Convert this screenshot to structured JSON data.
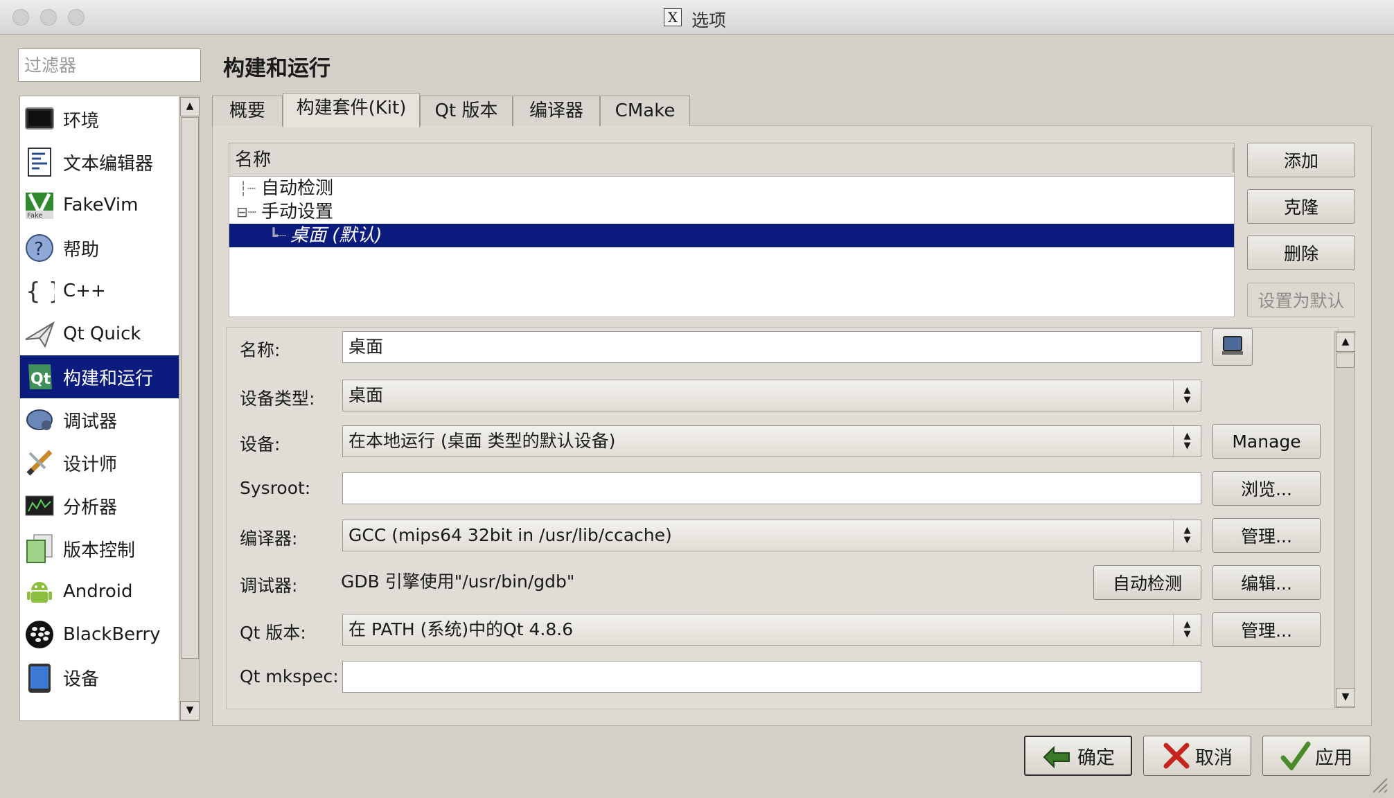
{
  "window": {
    "title": "选项"
  },
  "filter": {
    "placeholder": "过滤器"
  },
  "nav": {
    "items": [
      {
        "label": "环境",
        "icon": "monitor-icon"
      },
      {
        "label": "文本编辑器",
        "icon": "text-editor-icon"
      },
      {
        "label": "FakeVim",
        "icon": "fakevim-icon"
      },
      {
        "label": "帮助",
        "icon": "help-icon"
      },
      {
        "label": "C++",
        "icon": "braces-icon"
      },
      {
        "label": "Qt Quick",
        "icon": "paper-plane-icon"
      },
      {
        "label": "构建和运行",
        "icon": "qt-build-run-icon",
        "selected": true
      },
      {
        "label": "调试器",
        "icon": "debugger-bug-icon"
      },
      {
        "label": "设计师",
        "icon": "designer-pencil-icon"
      },
      {
        "label": "分析器",
        "icon": "analyzer-icon"
      },
      {
        "label": "版本控制",
        "icon": "version-control-icon"
      },
      {
        "label": "Android",
        "icon": "android-icon"
      },
      {
        "label": "BlackBerry",
        "icon": "blackberry-icon"
      },
      {
        "label": "设备",
        "icon": "device-tablet-icon"
      }
    ]
  },
  "page": {
    "heading": "构建和运行"
  },
  "tabs": [
    {
      "label": "概要"
    },
    {
      "label": "构建套件(Kit)",
      "active": true
    },
    {
      "label": "Qt 版本"
    },
    {
      "label": "编译器"
    },
    {
      "label": "CMake"
    }
  ],
  "kit_tree": {
    "header": "名称",
    "rows": [
      {
        "label": "自动检测",
        "prefix": "┆┈"
      },
      {
        "label": "手动设置",
        "prefix": "⊟┈"
      },
      {
        "label": "桌面 (默认)",
        "prefix": "┗┈",
        "selected": true
      }
    ]
  },
  "kit_buttons": {
    "add": "添加",
    "clone": "克隆",
    "remove": "删除",
    "make_default": "设置为默认"
  },
  "kit_form": {
    "name": {
      "label": "名称:",
      "value": "桌面"
    },
    "device_type": {
      "label": "设备类型:",
      "value": "桌面"
    },
    "device": {
      "label": "设备:",
      "value": "在本地运行 (桌面 类型的默认设备)",
      "button": "Manage"
    },
    "sysroot": {
      "label": "Sysroot:",
      "value": "",
      "button": "浏览..."
    },
    "compiler": {
      "label": "编译器:",
      "value": "GCC (mips64 32bit in /usr/lib/ccache)",
      "button": "管理..."
    },
    "debugger": {
      "label": "调试器:",
      "value": "GDB 引擎使用\"/usr/bin/gdb\"",
      "button_detect": "自动检测",
      "button_edit": "编辑..."
    },
    "qt_version": {
      "label": "Qt 版本:",
      "value": "在 PATH (系统)中的Qt 4.8.6",
      "button": "管理..."
    },
    "qt_mkspec": {
      "label": "Qt mkspec:",
      "value": ""
    }
  },
  "dialog_buttons": {
    "ok": "确定",
    "cancel": "取消",
    "apply": "应用"
  },
  "colors": {
    "selection": "#0b1b7e",
    "window_bg": "#d4d0c8",
    "ok_arrow": "#3c7a2a",
    "cancel_x": "#c4251e",
    "apply_check": "#4a8a2a"
  }
}
